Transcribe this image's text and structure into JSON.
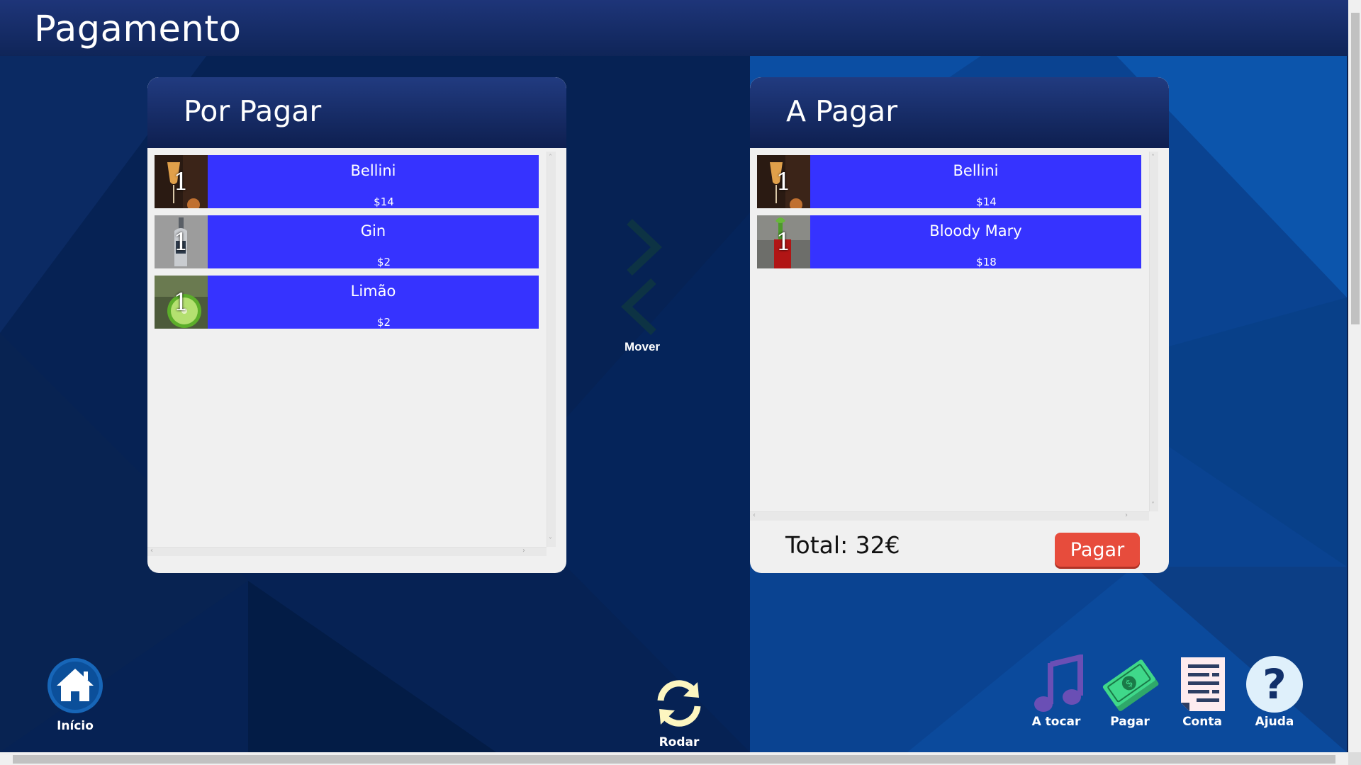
{
  "header": {
    "title": "Pagamento"
  },
  "left_panel": {
    "title": "Por Pagar",
    "items": [
      {
        "name": "Bellini",
        "price": "$14",
        "qty": "1",
        "thumb": "bellini-glass"
      },
      {
        "name": "Gin",
        "price": "$2",
        "qty": "1",
        "thumb": "gin-bottle"
      },
      {
        "name": "Limão",
        "price": "$2",
        "qty": "1",
        "thumb": "lime"
      }
    ]
  },
  "right_panel": {
    "title": "A Pagar",
    "items": [
      {
        "name": "Bellini",
        "price": "$14",
        "qty": "1",
        "thumb": "bellini-glass"
      },
      {
        "name": "Bloody Mary",
        "price": "$18",
        "qty": "1",
        "thumb": "bloody-mary-glass"
      }
    ],
    "total_label": "Total: 32€",
    "pay_button": "Pagar"
  },
  "move": {
    "label": "Mover"
  },
  "rotate": {
    "label": "Rodar"
  },
  "nav": {
    "home": "Início",
    "playing": "A tocar",
    "pay": "Pagar",
    "bill": "Conta",
    "help": "Ajuda"
  },
  "colors": {
    "item_bg": "#3633ff",
    "pay_button": "#e74c3c",
    "header_bg": "#1e3579",
    "page_bg": "#0a1f4d"
  }
}
